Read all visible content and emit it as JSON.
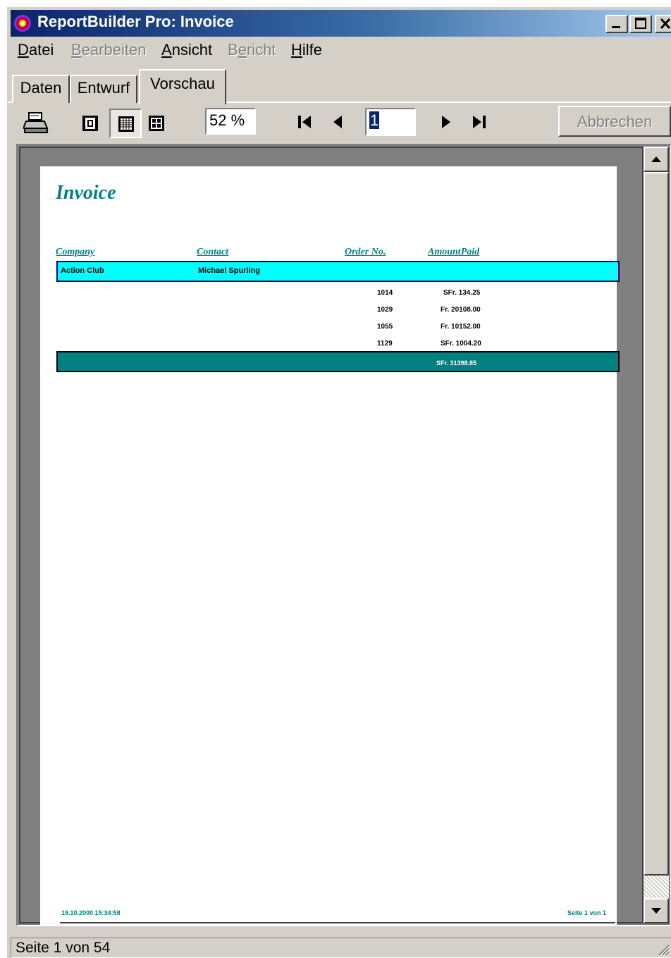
{
  "window": {
    "title": "ReportBuilder Pro: Invoice"
  },
  "menu": [
    {
      "pre": "",
      "acc": "D",
      "post": "atei",
      "enabled": true
    },
    {
      "pre": "",
      "acc": "B",
      "post": "earbeiten",
      "enabled": false
    },
    {
      "pre": "",
      "acc": "A",
      "post": "nsicht",
      "enabled": true
    },
    {
      "pre": "B",
      "acc": "e",
      "post": "richt",
      "enabled": false
    },
    {
      "pre": "",
      "acc": "H",
      "post": "ilfe",
      "enabled": true
    }
  ],
  "tabs": [
    "Daten",
    "Entwurf",
    "Vorschau"
  ],
  "toolbar": {
    "zoom": "52 %",
    "page": "1",
    "cancel_label": "Abbrechen",
    "icons": [
      "print-icon",
      "whole-page-icon",
      "page-width-icon",
      "hundred-percent-icon",
      "first-page-icon",
      "prior-page-icon",
      "next-page-icon",
      "last-page-icon"
    ]
  },
  "report": {
    "title": "Invoice",
    "columns": [
      "Company",
      "Contact",
      "Order No.",
      "AmountPaid"
    ],
    "group": {
      "company": "Action Club",
      "contact": "Michael Spurling"
    },
    "details": [
      {
        "order": "1014",
        "amount": "SFr. 134.25"
      },
      {
        "order": "1029",
        "amount": "Fr. 20108.00"
      },
      {
        "order": "1055",
        "amount": "Fr. 10152.00"
      },
      {
        "order": "1129",
        "amount": "SFr. 1004.20"
      }
    ],
    "total": "SFr. 31398.85",
    "footer": {
      "date": "19.10.2000 15:34:58",
      "page": "Seite 1 von 1"
    }
  },
  "colors": {
    "accent": "#008080",
    "group_header": "#00ffff",
    "titlebar": "#0a246a"
  },
  "status": "Seite 1 von 54"
}
